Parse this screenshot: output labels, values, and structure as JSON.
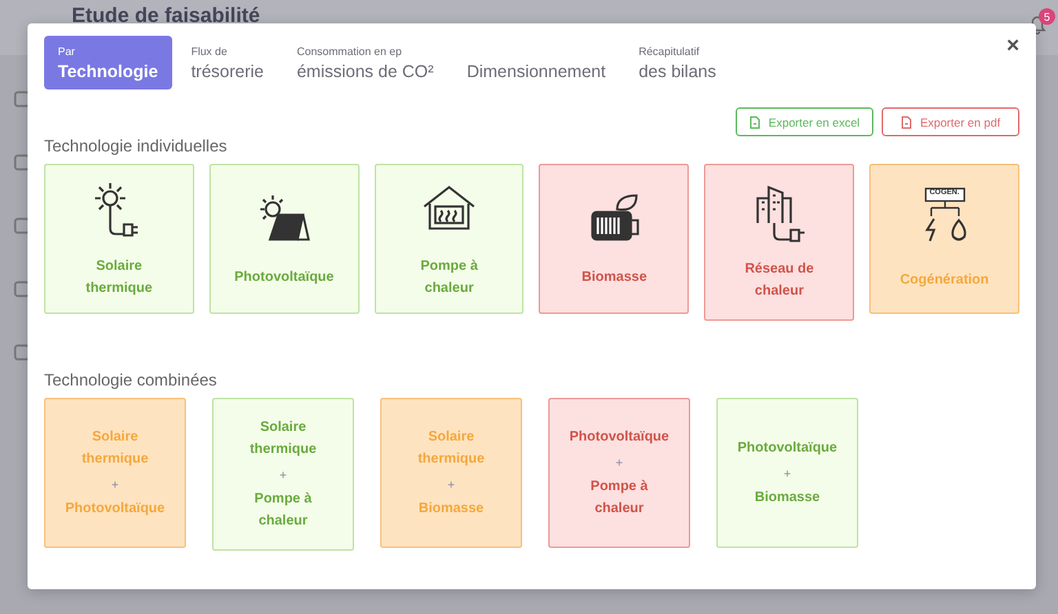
{
  "background": {
    "title": "Etude de faisabilité",
    "notification_count": "5"
  },
  "tabs": [
    {
      "small": "Par",
      "label": "Technologie",
      "selected": true
    },
    {
      "small": "Flux de",
      "label": "trésorerie",
      "selected": false
    },
    {
      "small": "Consommation en ep",
      "label": "émissions de CO²",
      "selected": false
    },
    {
      "label": "Dimensionnement",
      "selected": false
    },
    {
      "small": "Récapitulatif",
      "label": "des bilans",
      "selected": false
    }
  ],
  "close": "×",
  "exports": [
    {
      "kind": "excel",
      "label": "Exporter en excel"
    },
    {
      "kind": "pdf",
      "label": "Exporter en pdf"
    }
  ],
  "individual": {
    "title": "Technologie individuelles",
    "cards": [
      {
        "label": "Solaire thermique",
        "color": "#6aab3f"
      },
      {
        "label": "Photovoltaïque",
        "color": "#6aab3f"
      },
      {
        "label": "Pompe à chaleur",
        "color": "#6aab3f"
      },
      {
        "label": "Biomasse",
        "color": "#d0544a"
      },
      {
        "label": "Réseau de chaleur",
        "color": "#d0544a"
      },
      {
        "label": "Cogénération",
        "color": "#f5a83c"
      }
    ]
  },
  "combined": {
    "title": "Technologie combinées",
    "cards": [
      {
        "parts": [
          "Solaire thermique",
          "Photovoltaïque"
        ],
        "joiner": "+",
        "color": "#f5a83c"
      },
      {
        "parts": [
          "Solaire thermique",
          "Pompe à chaleur"
        ],
        "joiner": "+",
        "color": "#6aab3f"
      },
      {
        "parts": [
          "Solaire thermique",
          "Biomasse"
        ],
        "joiner": "+",
        "color": "#f5a83c"
      },
      {
        "parts": [
          "Photovoltaïque",
          "Pompe à chaleur"
        ],
        "joiner": "+",
        "color": "#d0544a"
      },
      {
        "parts": [
          "Photovoltaïque",
          "Biomasse"
        ],
        "joiner": "+",
        "color": "#6aab3f"
      }
    ]
  },
  "cogen_icon_label": "COGEN."
}
